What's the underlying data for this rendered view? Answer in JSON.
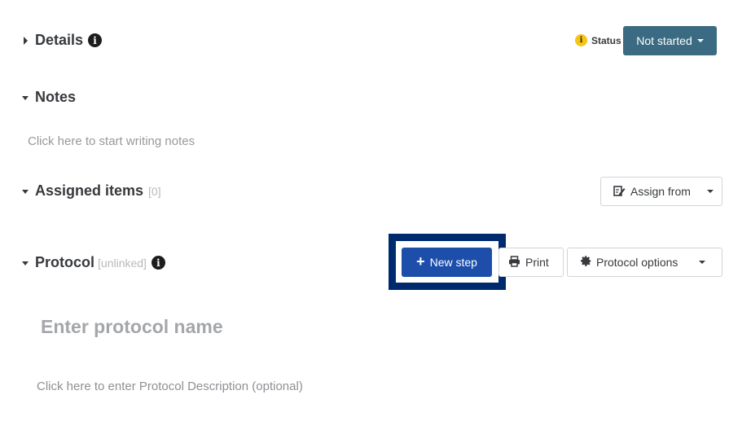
{
  "details": {
    "title": "Details"
  },
  "status": {
    "label": "Status",
    "button_label": "Not started"
  },
  "notes": {
    "title": "Notes",
    "placeholder": "Click here to start writing notes"
  },
  "assigned_items": {
    "title": "Assigned items",
    "count": "[0]",
    "assign_button_label": "Assign from"
  },
  "protocol": {
    "title": "Protocol",
    "link_state": "[unlinked]",
    "new_step_label": "New step",
    "print_label": "Print",
    "options_label": "Protocol options",
    "name_placeholder": "Enter protocol name",
    "description_placeholder": "Click here to enter Protocol Description (optional)"
  },
  "colors": {
    "status_button": "#3b6b82",
    "primary_button": "#1d4eaa",
    "focus_frame": "#002a6e",
    "status_dot": "#f5c518"
  },
  "icons": [
    "info-icon",
    "status-info-icon",
    "caret-right-icon",
    "caret-down-icon",
    "assign-edit-icon",
    "plus-icon",
    "printer-icon",
    "gear-icon",
    "chevron-down-icon"
  ]
}
